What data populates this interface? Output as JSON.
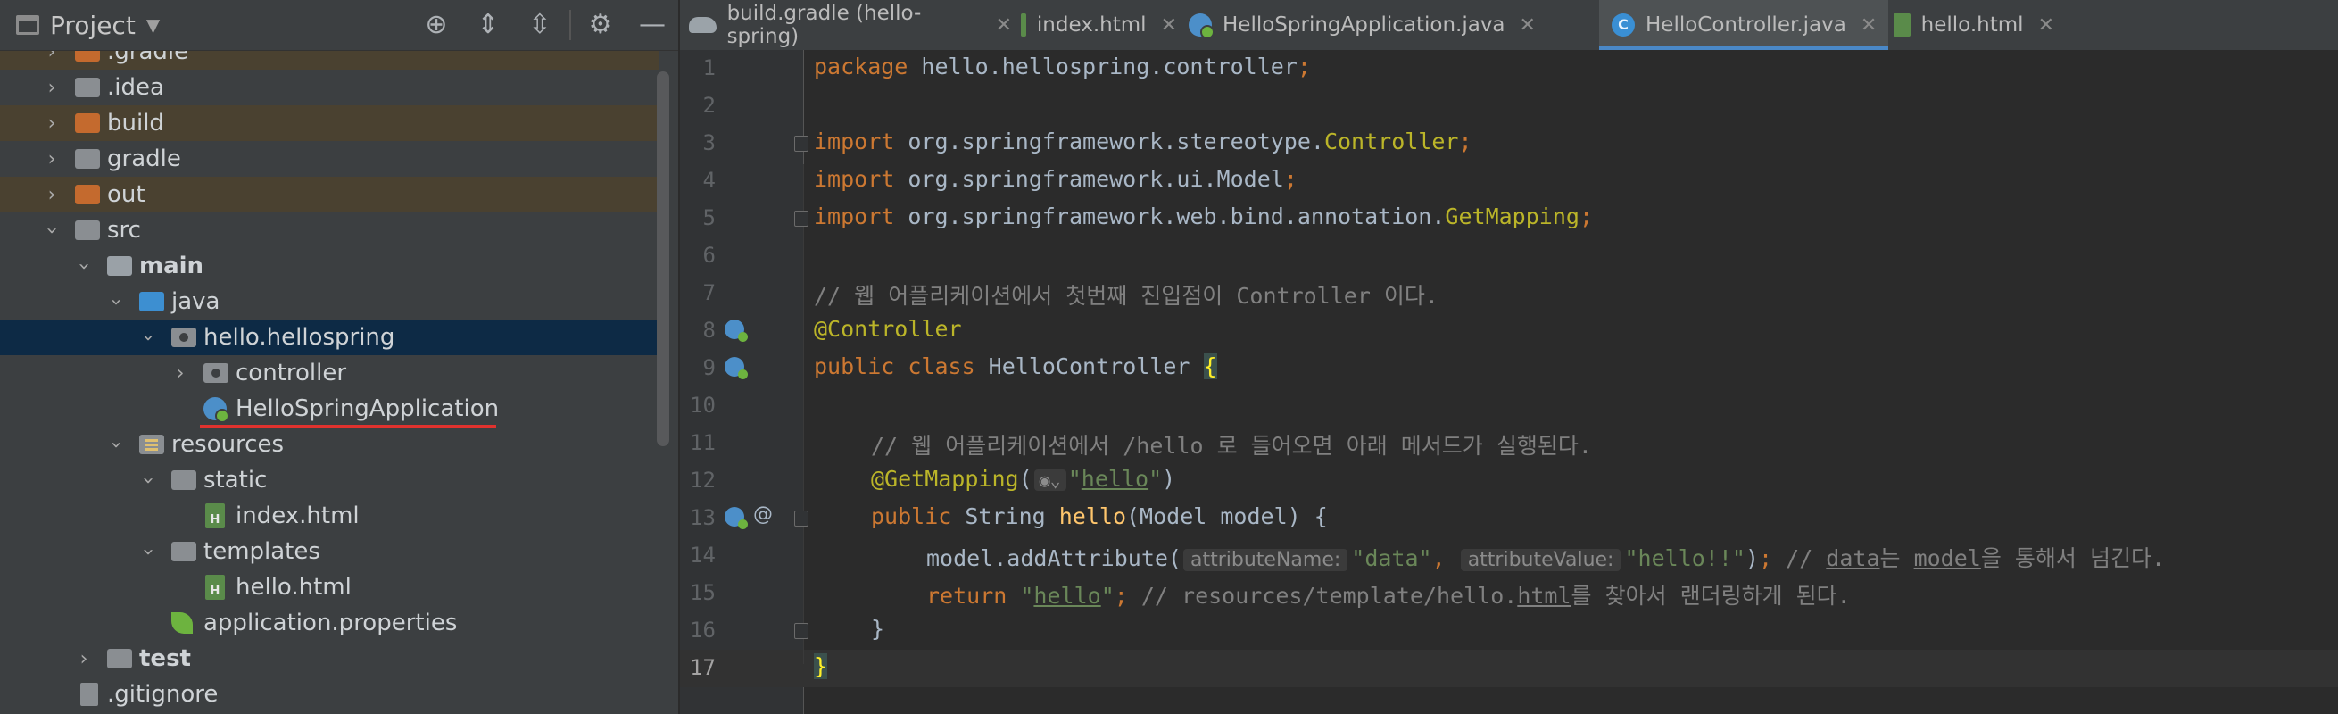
{
  "project_panel": {
    "title": "Project",
    "tree": [
      {
        "label": ".gradle",
        "excluded": true
      },
      {
        "label": ".idea"
      },
      {
        "label": "build",
        "excluded": true
      },
      {
        "label": "gradle"
      },
      {
        "label": "out",
        "excluded": true
      },
      {
        "label": "src"
      },
      {
        "label": "main"
      },
      {
        "label": "java"
      },
      {
        "label": "hello.hellospring",
        "selected": true
      },
      {
        "label": "controller"
      },
      {
        "label": "HelloSpringApplication"
      },
      {
        "label": "resources"
      },
      {
        "label": "static"
      },
      {
        "label": "index.html"
      },
      {
        "label": "templates"
      },
      {
        "label": "hello.html"
      },
      {
        "label": "application.properties"
      },
      {
        "label": "test"
      },
      {
        "label": ".gitignore"
      }
    ]
  },
  "tabs": [
    {
      "label": "build.gradle (hello-spring)"
    },
    {
      "label": "index.html"
    },
    {
      "label": "HelloSpringApplication.java"
    },
    {
      "label": "HelloController.java",
      "active": true
    },
    {
      "label": "hello.html"
    }
  ],
  "editor": {
    "line_numbers": [
      "1",
      "2",
      "3",
      "4",
      "5",
      "6",
      "7",
      "8",
      "9",
      "10",
      "11",
      "12",
      "13",
      "14",
      "15",
      "16",
      "17"
    ],
    "current_line": "17",
    "tokens": {
      "l1_kw": "package",
      "l1_rest": " hello.hellospring.controller",
      "l1_semi": ";",
      "import": "import",
      "l3_pkg": " org.springframework.stereotype.",
      "l3_cls": "Controller",
      "l4_pkg": " org.springframework.ui.Model",
      "l5_pkg": " org.springframework.web.bind.annotation.",
      "l5_cls": "GetMapping",
      "semi": ";",
      "l7_comment": "// 웹 어플리케이션에서 첫번째 진입점이 Controller 이다.",
      "l8_ann": "@Controller",
      "l9_kw": "public class",
      "l9_name": " HelloController ",
      "l9_brace": "{",
      "l11_comment": "// 웹 어플리케이션에서 /hello 로 들어오면 아래 메서드가 실행된다.",
      "l12_ann": "@GetMapping",
      "l12_open": "(",
      "l12_hint": "◉⌄",
      "l12_str_q1": "\"",
      "l12_str": "hello",
      "l12_str_q2": "\"",
      "l12_close": ")",
      "l13_kw": "public",
      "l13_type": " String ",
      "l13_fn": "hello",
      "l13_params": "(Model model) {",
      "l14_call": "model.addAttribute(",
      "l14_hint1": "attributeName:",
      "l14_arg1": "\"data\"",
      "l14_comma": ", ",
      "l14_hint2": "attributeValue:",
      "l14_arg2": "\"hello!!\"",
      "l14_close": ")",
      "l14_comment_a": "// ",
      "l14_comment_b": "data",
      "l14_comment_c": "는 ",
      "l14_comment_d": "model",
      "l14_comment_e": "을 통해서 넘긴다.",
      "l15_kw": "return",
      "l15_q1": " \"",
      "l15_str": "hello",
      "l15_q2": "\"",
      "l15_comment_a": " // resources/template/hello.",
      "l15_comment_b": "html",
      "l15_comment_c": "를 찾아서 랜더링하게 된다.",
      "l16_brace": "}",
      "l17_brace": "}"
    }
  }
}
